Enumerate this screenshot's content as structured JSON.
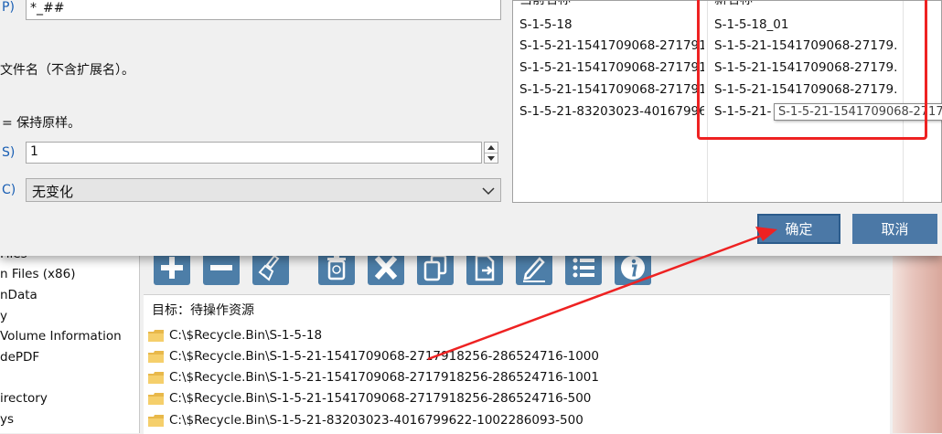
{
  "dialog": {
    "pattern_label": "P)",
    "pattern_value": "*_##",
    "note_filename": "文件名（不含扩展名）。",
    "note_keep": "= 保持原样。",
    "start_label": "S)",
    "start_value": "1",
    "case_label": "C)",
    "case_value": "无变化",
    "table": {
      "headers": [
        "当前名称",
        "新名称"
      ],
      "rows": [
        {
          "current": "S-1-5-18",
          "new": "S-1-5-18_01"
        },
        {
          "current": "S-1-5-21-1541709068-271791...",
          "new": "S-1-5-21-1541709068-27179..."
        },
        {
          "current": "S-1-5-21-1541709068-271791...",
          "new": "S-1-5-21-1541709068-27179..."
        },
        {
          "current": "S-1-5-21-1541709068-271791...",
          "new": "S-1-5-21-1541709068-27179..."
        },
        {
          "current": "S-1-5-21-83203023-40167996...",
          "new": "S-1-5-21-"
        }
      ]
    },
    "tooltip": "S-1-5-21-1541709068-27179",
    "ok_label": "确定",
    "cancel_label": "取消"
  },
  "tree": {
    "items": [
      "Files",
      "n Files (x86)",
      "nData",
      "y",
      "Volume Information",
      "dePDF",
      "irectory",
      "ys"
    ]
  },
  "target": {
    "label": "目标：待操作资源",
    "files": [
      "C:\\$Recycle.Bin\\S-1-5-18",
      "C:\\$Recycle.Bin\\S-1-5-21-1541709068-2717918256-286524716-1000",
      "C:\\$Recycle.Bin\\S-1-5-21-1541709068-2717918256-286524716-1001",
      "C:\\$Recycle.Bin\\S-1-5-21-1541709068-2717918256-286524716-500",
      "C:\\$Recycle.Bin\\S-1-5-21-83203023-4016799622-1002286093-500"
    ]
  },
  "toolbar": {
    "icons": [
      "add-icon",
      "remove-icon",
      "clean-icon",
      "recycle-icon",
      "delete-icon",
      "copy-icon",
      "move-icon",
      "rename-icon",
      "list-icon",
      "info-icon"
    ]
  },
  "colors": {
    "accent": "#4b78a6",
    "highlight": "#ee2222",
    "arrow": "#ee2222"
  }
}
